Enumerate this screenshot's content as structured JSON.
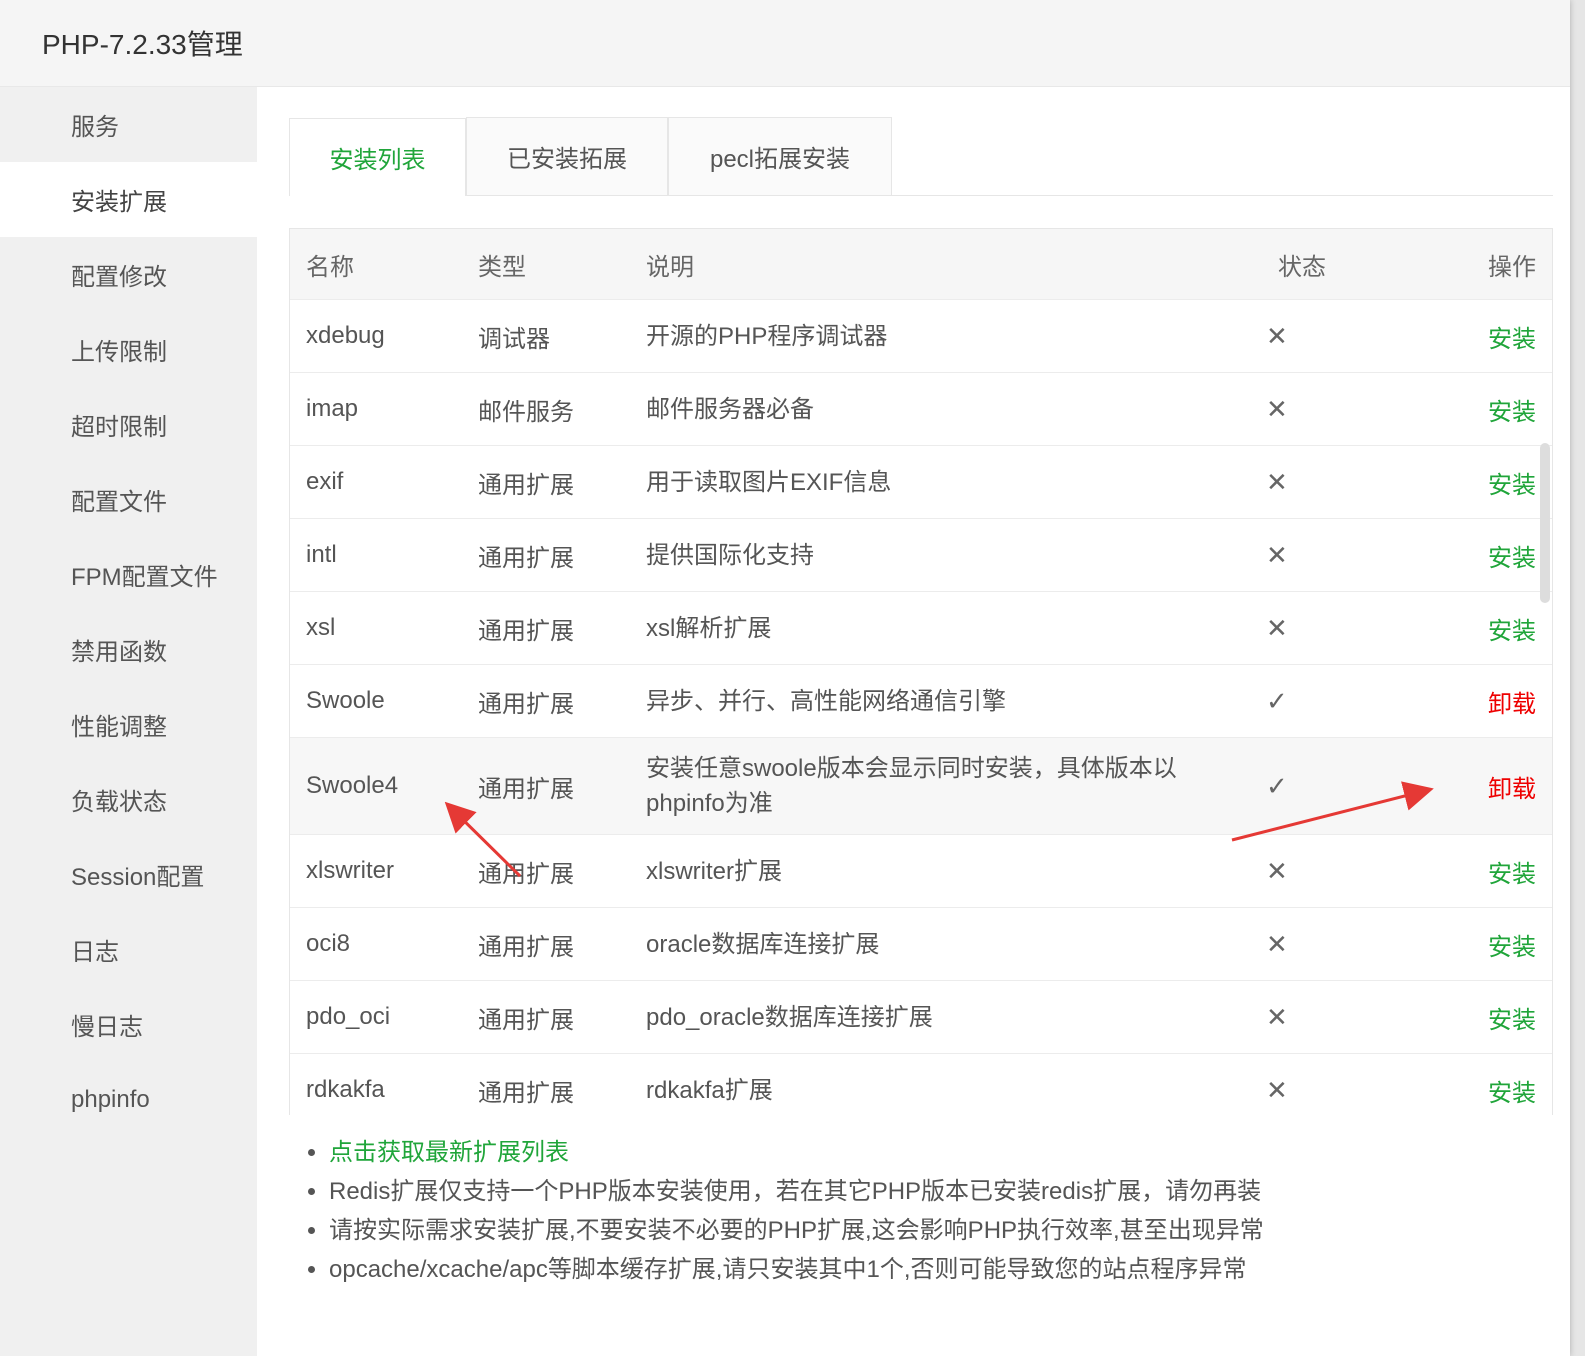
{
  "window": {
    "title": "PHP-7.2.33管理"
  },
  "sidebar": {
    "items": [
      {
        "label": "服务"
      },
      {
        "label": "安装扩展",
        "active": true
      },
      {
        "label": "配置修改"
      },
      {
        "label": "上传限制"
      },
      {
        "label": "超时限制"
      },
      {
        "label": "配置文件"
      },
      {
        "label": "FPM配置文件"
      },
      {
        "label": "禁用函数"
      },
      {
        "label": "性能调整"
      },
      {
        "label": "负载状态"
      },
      {
        "label": "Session配置"
      },
      {
        "label": "日志"
      },
      {
        "label": "慢日志"
      },
      {
        "label": "phpinfo"
      }
    ]
  },
  "tabs": [
    {
      "label": "安装列表",
      "active": true
    },
    {
      "label": "已安装拓展"
    },
    {
      "label": "pecl拓展安装"
    }
  ],
  "table": {
    "headers": {
      "name": "名称",
      "type": "类型",
      "desc": "说明",
      "status": "状态",
      "op": "操作"
    },
    "rows": [
      {
        "name": "xdebug",
        "type": "调试器",
        "desc": "开源的PHP程序调试器",
        "status": "✕",
        "op": "安装"
      },
      {
        "name": "imap",
        "type": "邮件服务",
        "desc": "邮件服务器必备",
        "status": "✕",
        "op": "安装"
      },
      {
        "name": "exif",
        "type": "通用扩展",
        "desc": "用于读取图片EXIF信息",
        "status": "✕",
        "op": "安装"
      },
      {
        "name": "intl",
        "type": "通用扩展",
        "desc": "提供国际化支持",
        "status": "✕",
        "op": "安装"
      },
      {
        "name": "xsl",
        "type": "通用扩展",
        "desc": "xsl解析扩展",
        "status": "✕",
        "op": "安装"
      },
      {
        "name": "Swoole",
        "type": "通用扩展",
        "desc": "异步、并行、高性能网络通信引擎",
        "status": "✓",
        "op": "卸载"
      },
      {
        "name": "Swoole4",
        "type": "通用扩展",
        "desc": "安装任意swoole版本会显示同时安装，具体版本以phpinfo为准",
        "status": "✓",
        "op": "卸载"
      },
      {
        "name": "xlswriter",
        "type": "通用扩展",
        "desc": "xlswriter扩展",
        "status": "✕",
        "op": "安装"
      },
      {
        "name": "oci8",
        "type": "通用扩展",
        "desc": "oracle数据库连接扩展",
        "status": "✕",
        "op": "安装"
      },
      {
        "name": "pdo_oci",
        "type": "通用扩展",
        "desc": "pdo_oracle数据库连接扩展",
        "status": "✕",
        "op": "安装"
      },
      {
        "name": "rdkakfa",
        "type": "通用扩展",
        "desc": "rdkakfa扩展",
        "status": "✕",
        "op": "安装"
      }
    ]
  },
  "notes": {
    "refresh_link": "点击获取最新扩展列表",
    "items": [
      "Redis扩展仅支持一个PHP版本安装使用，若在其它PHP版本已安装redis扩展，请勿再装",
      "请按实际需求安装扩展,不要安装不必要的PHP扩展,这会影响PHP执行效率,甚至出现异常",
      "opcache/xcache/apc等脚本缓存扩展,请只安装其中1个,否则可能导致您的站点程序异常"
    ]
  },
  "colors": {
    "accent_green": "#20a53a",
    "uninstall_red": "#e00000",
    "annotation_arrow": "#e53935"
  }
}
